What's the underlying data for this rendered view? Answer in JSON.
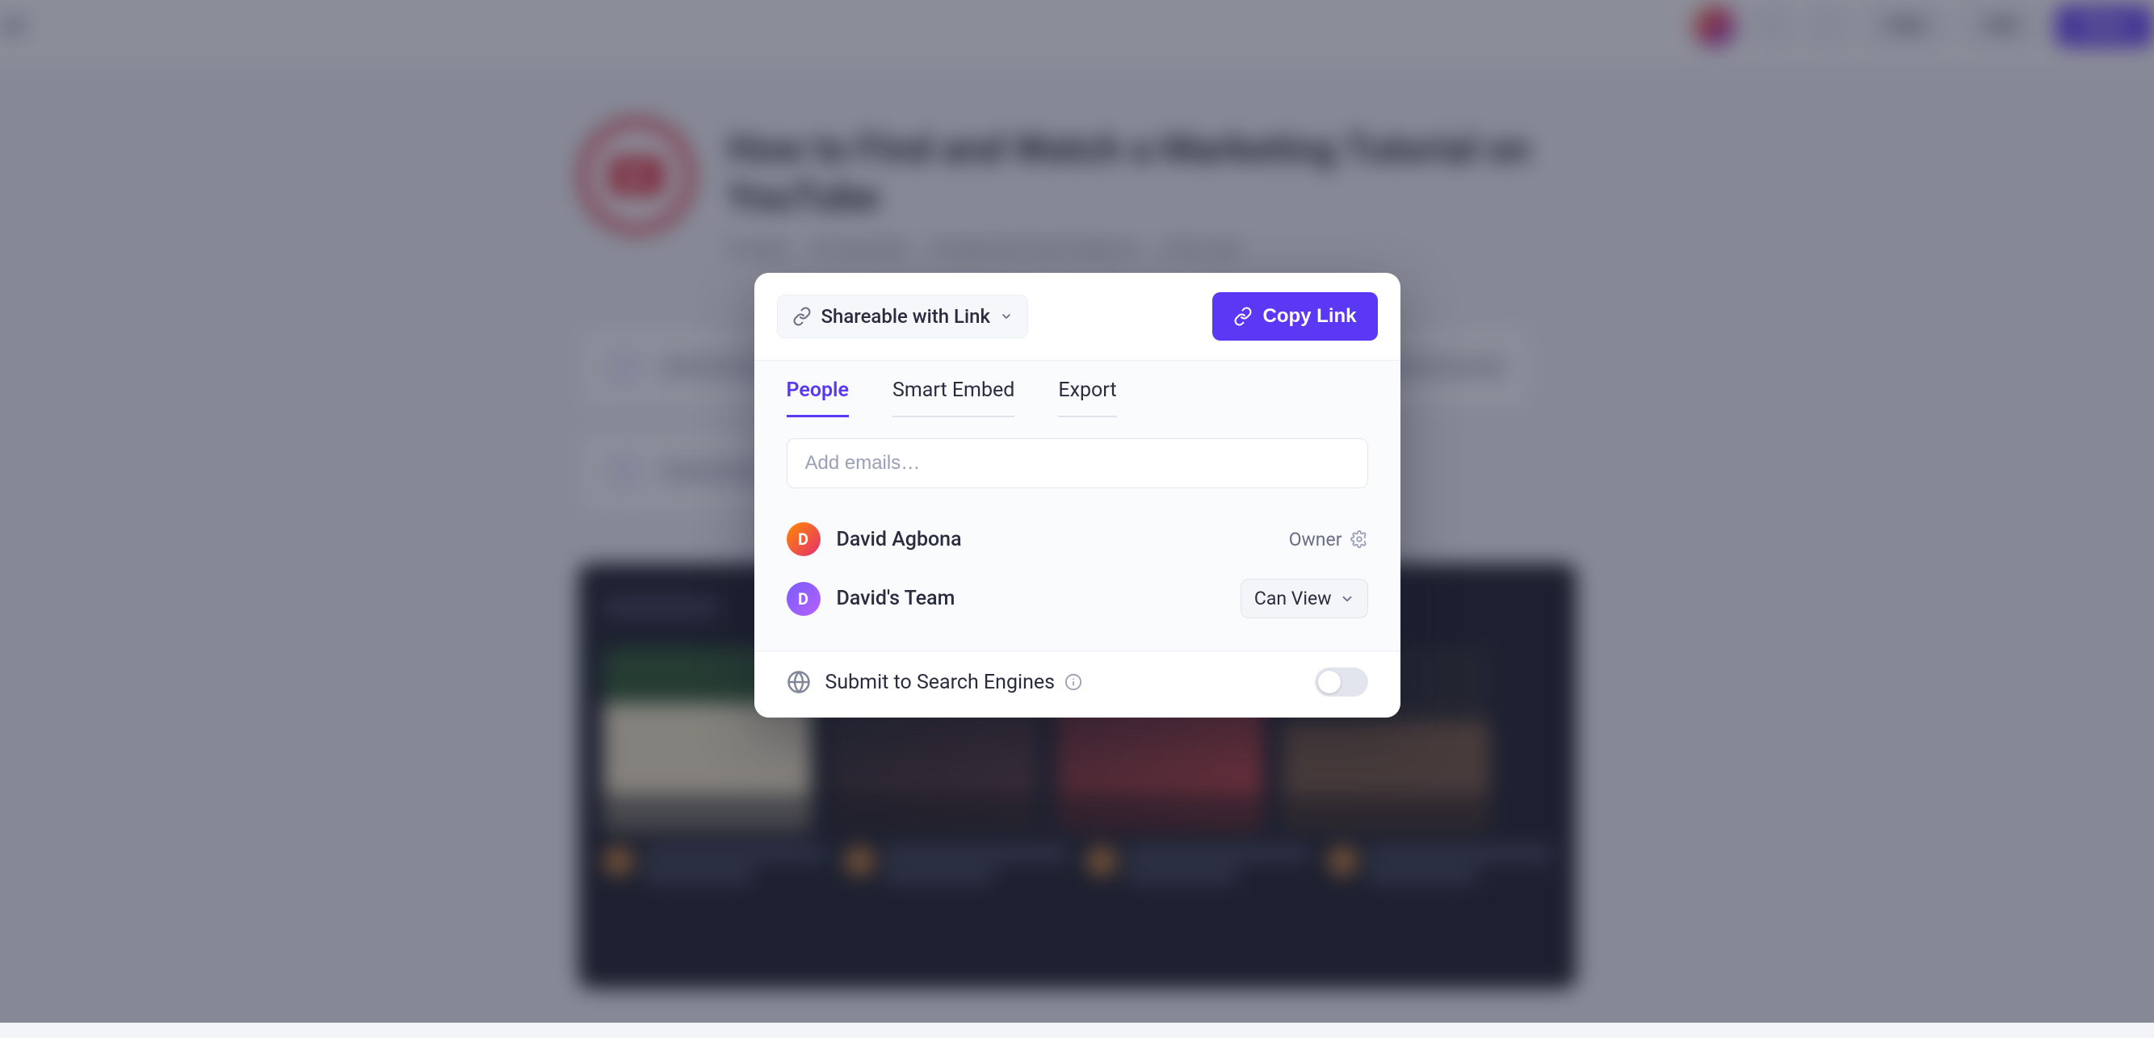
{
  "topbar": {
    "help_label": "Help",
    "edit_label": "Edit",
    "share_label": "Share"
  },
  "page": {
    "title": "How to Find and Watch a Marketing Tutorial on YouTube",
    "meta": {
      "steps": "8 steps",
      "duration": "25 seconds",
      "author": "Created by David Agbona",
      "ago": "a few ago"
    }
  },
  "modal": {
    "shareable_label": "Shareable with Link",
    "copy_label": "Copy Link",
    "tabs": {
      "people": "People",
      "smart_embed": "Smart Embed",
      "export": "Export"
    },
    "email_placeholder": "Add emails…",
    "people": [
      {
        "initial": "D",
        "name": "David Agbona",
        "role_type": "owner",
        "role_label": "Owner"
      },
      {
        "initial": "D",
        "name": "David's Team",
        "role_type": "select",
        "role_label": "Can View"
      }
    ],
    "seo_label": "Submit to Search Engines",
    "seo_enabled": false
  }
}
